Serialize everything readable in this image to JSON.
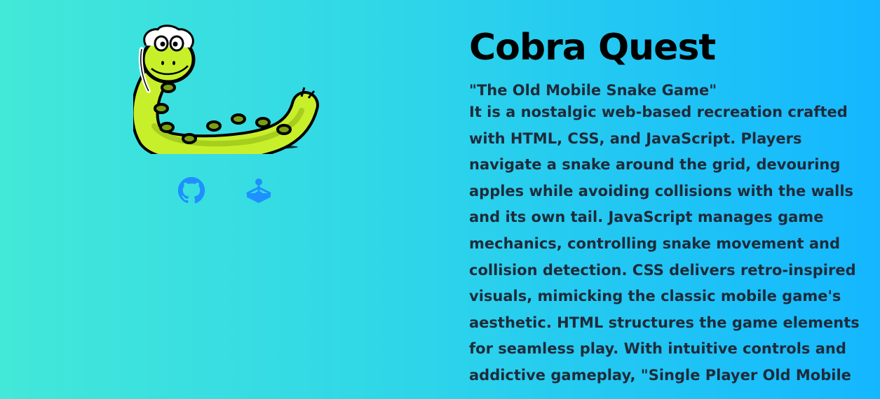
{
  "project": {
    "title": "Cobra Quest",
    "subtitle": "\"The Old Mobile Snake Game\"",
    "description": "It is a nostalgic web-based recreation crafted with HTML, CSS, and JavaScript. Players navigate a snake around the grid, devouring apples while avoiding collisions with the walls and its own tail. JavaScript manages game mechanics, controlling snake movement and collision detection. CSS delivers retro-inspired visuals, mimicking the classic mobile game's aesthetic. HTML structures the game elements for seamless play. With intuitive controls and addictive gameplay, \"Single Player Old Mobile"
  },
  "links": [
    {
      "icon": "github-icon"
    },
    {
      "icon": "joystick-icon"
    }
  ],
  "colors": {
    "gradient_start": "#43e8d8",
    "gradient_end": "#14b7ff",
    "icon_blue": "#1e90ff",
    "snake_green": "#c8f02a",
    "text_dark": "#1f2b3a"
  }
}
